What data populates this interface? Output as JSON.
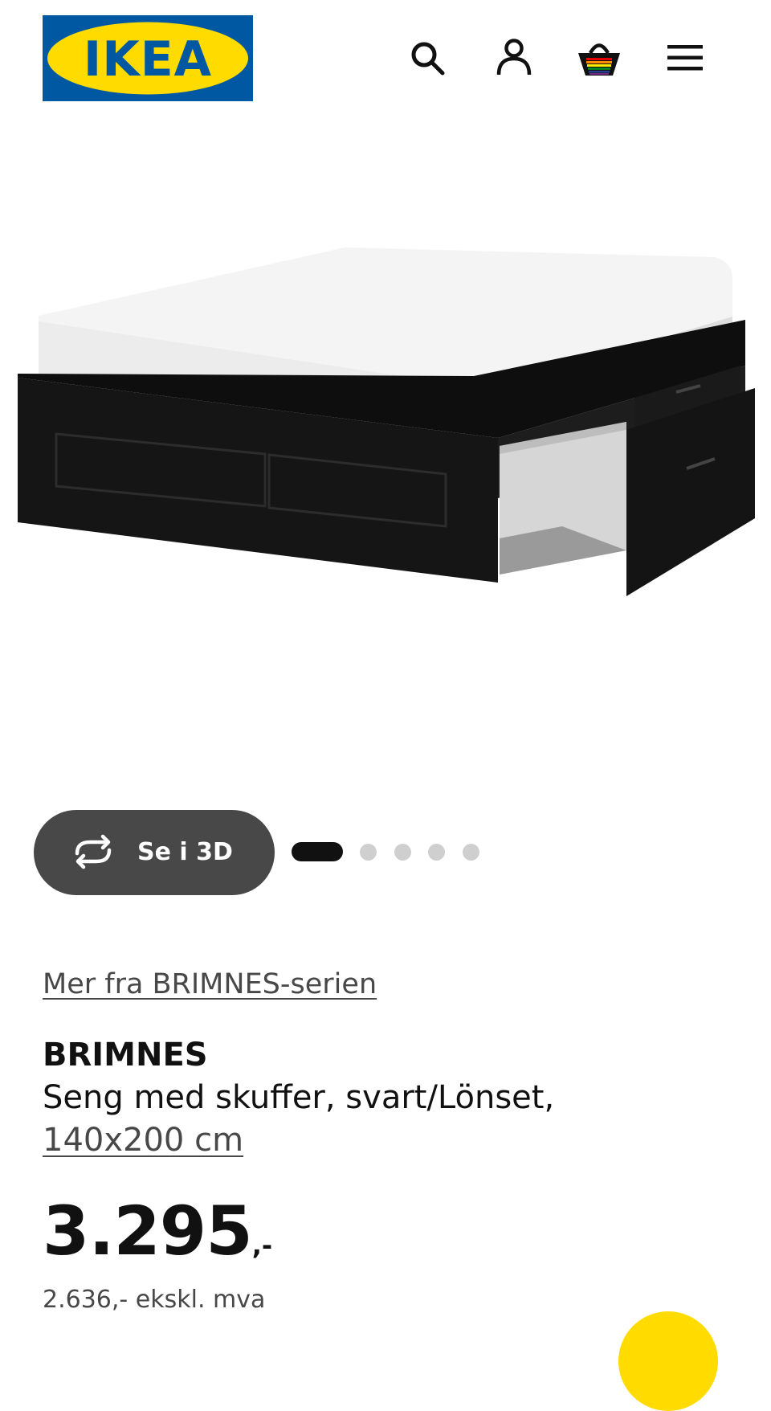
{
  "header": {
    "logo_text": "IKEA",
    "brand_colors": {
      "blue": "#0058A3",
      "yellow": "#FFDB00"
    },
    "icons": [
      "search-icon",
      "user-icon",
      "shopping-bag-icon",
      "menu-icon"
    ]
  },
  "gallery": {
    "view_3d_label": "Se i 3D",
    "view_3d_icon": "rotate-3d-icon",
    "slide_count": 5,
    "active_slide": 1
  },
  "product": {
    "series_link": "Mer fra BRIMNES-serien",
    "name": "BRIMNES",
    "description": "Seng med skuffer, svart/Lönset,",
    "size": "140x200 cm",
    "price": "3.295",
    "price_suffix": ",-",
    "price_ex_vat": "2.636,- ekskl. mva"
  },
  "colors": {
    "text": "#111111",
    "muted": "#484848",
    "button_3d": "#484848",
    "dot_active": "#111111",
    "dot_inactive": "#cfcfcf"
  }
}
